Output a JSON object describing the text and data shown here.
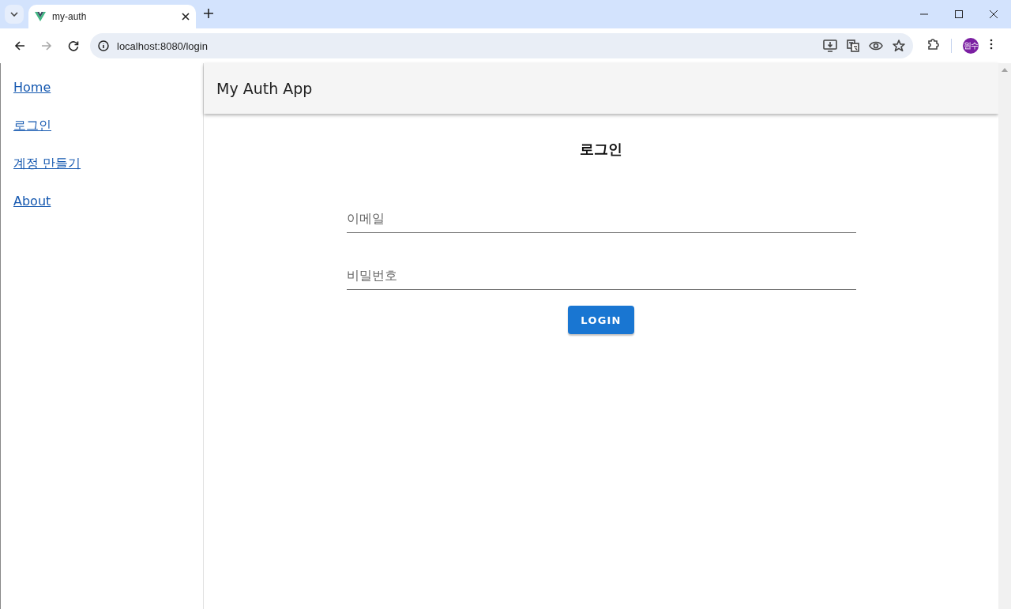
{
  "browser": {
    "tab": {
      "title": "my-auth",
      "selected": true
    },
    "nav_buttons": [
      {
        "kind": "back",
        "disabled": false
      },
      {
        "kind": "forward",
        "disabled": true
      },
      {
        "kind": "reload",
        "disabled": false
      }
    ],
    "url": "localhost:8080/login",
    "profile": "원수"
  },
  "sidebar": {
    "links": [
      {
        "label": "Home"
      },
      {
        "label": "로그인"
      },
      {
        "label": "계정 만들기"
      },
      {
        "label": "About"
      }
    ]
  },
  "app_bar": {
    "title": "My Auth App"
  },
  "form": {
    "title": "로그인",
    "fields": [
      {
        "placeholder": "이메일"
      },
      {
        "placeholder": "비밀번호"
      }
    ],
    "submit": "LOGIN"
  }
}
